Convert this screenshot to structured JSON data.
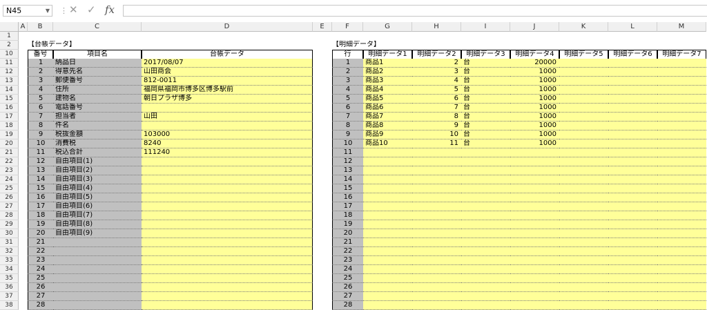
{
  "formula_bar": {
    "name_box": "N45",
    "formula": ""
  },
  "columns": [
    "A",
    "B",
    "C",
    "D",
    "E",
    "F",
    "G",
    "H",
    "I",
    "J",
    "K",
    "L",
    "M"
  ],
  "rows": [
    1,
    2,
    10,
    11,
    12,
    13,
    14,
    15,
    16,
    17,
    18,
    19,
    20,
    21,
    22,
    23,
    24,
    25,
    26,
    27,
    28,
    29,
    30,
    31,
    32,
    33,
    34,
    35,
    36,
    37,
    38
  ],
  "ledger": {
    "title": "【台帳データ】",
    "headers": [
      "番号",
      "項目名",
      "台帳データ"
    ],
    "items": [
      {
        "no": "1",
        "name": "納品日",
        "value": "2017/08/07"
      },
      {
        "no": "2",
        "name": "得意先名",
        "value": "山田商会"
      },
      {
        "no": "3",
        "name": "郵便番号",
        "value": "812-0011"
      },
      {
        "no": "4",
        "name": "住所",
        "value": "福岡県福岡市博多区博多駅前"
      },
      {
        "no": "5",
        "name": "建物名",
        "value": "朝日プラザ博多"
      },
      {
        "no": "6",
        "name": "電話番号",
        "value": ""
      },
      {
        "no": "7",
        "name": "担当者",
        "value": "山田"
      },
      {
        "no": "8",
        "name": "件名",
        "value": ""
      },
      {
        "no": "9",
        "name": "税抜金額",
        "value": "103000"
      },
      {
        "no": "10",
        "name": "消費税",
        "value": "8240"
      },
      {
        "no": "11",
        "name": "税込合計",
        "value": "111240"
      },
      {
        "no": "12",
        "name": "自由項目(1)",
        "value": ""
      },
      {
        "no": "13",
        "name": "自由項目(2)",
        "value": ""
      },
      {
        "no": "14",
        "name": "自由項目(3)",
        "value": ""
      },
      {
        "no": "15",
        "name": "自由項目(4)",
        "value": ""
      },
      {
        "no": "16",
        "name": "自由項目(5)",
        "value": ""
      },
      {
        "no": "17",
        "name": "自由項目(6)",
        "value": ""
      },
      {
        "no": "18",
        "name": "自由項目(7)",
        "value": ""
      },
      {
        "no": "19",
        "name": "自由項目(8)",
        "value": ""
      },
      {
        "no": "20",
        "name": "自由項目(9)",
        "value": ""
      },
      {
        "no": "21",
        "name": "",
        "value": ""
      },
      {
        "no": "22",
        "name": "",
        "value": ""
      },
      {
        "no": "23",
        "name": "",
        "value": ""
      },
      {
        "no": "24",
        "name": "",
        "value": ""
      },
      {
        "no": "25",
        "name": "",
        "value": ""
      },
      {
        "no": "26",
        "name": "",
        "value": ""
      },
      {
        "no": "27",
        "name": "",
        "value": ""
      },
      {
        "no": "28",
        "name": "",
        "value": ""
      }
    ]
  },
  "detail": {
    "title": "【明細データ】",
    "headers": [
      "行",
      "明細データ1",
      "明細データ2",
      "明細データ3",
      "明細データ4",
      "明細データ5",
      "明細データ6",
      "明細データ7"
    ],
    "items": [
      {
        "row": "1",
        "d1": "商品1",
        "d2": "2",
        "d3": "台",
        "d4": "20000"
      },
      {
        "row": "2",
        "d1": "商品2",
        "d2": "3",
        "d3": "台",
        "d4": "1000"
      },
      {
        "row": "3",
        "d1": "商品3",
        "d2": "4",
        "d3": "台",
        "d4": "1000"
      },
      {
        "row": "4",
        "d1": "商品4",
        "d2": "5",
        "d3": "台",
        "d4": "1000"
      },
      {
        "row": "5",
        "d1": "商品5",
        "d2": "6",
        "d3": "台",
        "d4": "1000"
      },
      {
        "row": "6",
        "d1": "商品6",
        "d2": "7",
        "d3": "台",
        "d4": "1000"
      },
      {
        "row": "7",
        "d1": "商品7",
        "d2": "8",
        "d3": "台",
        "d4": "1000"
      },
      {
        "row": "8",
        "d1": "商品8",
        "d2": "9",
        "d3": "台",
        "d4": "1000"
      },
      {
        "row": "9",
        "d1": "商品9",
        "d2": "10",
        "d3": "台",
        "d4": "1000"
      },
      {
        "row": "10",
        "d1": "商品10",
        "d2": "11",
        "d3": "台",
        "d4": "1000"
      },
      {
        "row": "11"
      },
      {
        "row": "12"
      },
      {
        "row": "13"
      },
      {
        "row": "14"
      },
      {
        "row": "15"
      },
      {
        "row": "16"
      },
      {
        "row": "17"
      },
      {
        "row": "18"
      },
      {
        "row": "19"
      },
      {
        "row": "20"
      },
      {
        "row": "21"
      },
      {
        "row": "22"
      },
      {
        "row": "23"
      },
      {
        "row": "24"
      },
      {
        "row": "25"
      },
      {
        "row": "26"
      },
      {
        "row": "27"
      },
      {
        "row": "28"
      }
    ]
  }
}
